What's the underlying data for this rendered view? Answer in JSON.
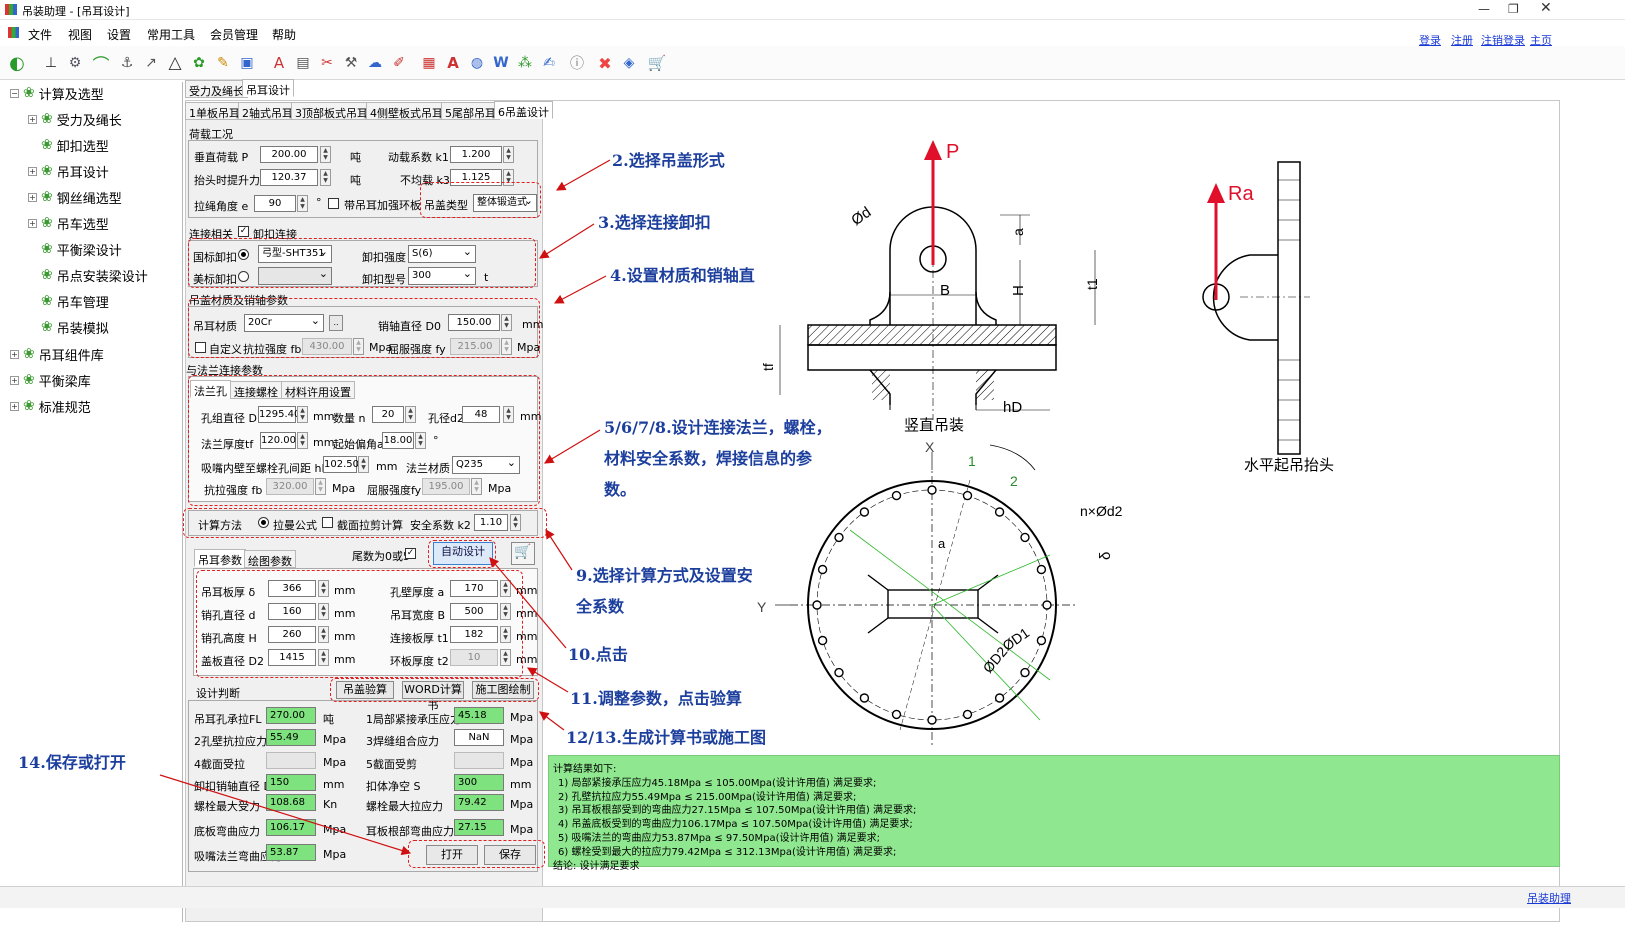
{
  "window": {
    "title": "吊装助理 - [吊耳设计]"
  },
  "menu": [
    "文件",
    "视图",
    "设置",
    "常用工具",
    "会员管理",
    "帮助"
  ],
  "top_links": [
    "登录",
    "注册",
    "注销登录",
    "主页"
  ],
  "tree": [
    {
      "label": "计算及选型",
      "level": 0
    },
    {
      "label": "受力及绳长",
      "level": 1
    },
    {
      "label": "卸扣选型",
      "level": 1
    },
    {
      "label": "吊耳设计",
      "level": 1
    },
    {
      "label": "钢丝绳选型",
      "level": 1
    },
    {
      "label": "吊车选型",
      "level": 1
    },
    {
      "label": "平衡梁设计",
      "level": 1
    },
    {
      "label": "吊点安装梁设计",
      "level": 1
    },
    {
      "label": "吊车管理",
      "level": 1
    },
    {
      "label": "吊装模拟",
      "level": 1
    },
    {
      "label": "吊耳组件库",
      "level": 0
    },
    {
      "label": "平衡梁库",
      "level": 0
    },
    {
      "label": "标准规范",
      "level": 0
    }
  ],
  "outer_tabs": [
    "受力及绳长",
    "吊耳设计"
  ],
  "inner_tabs": [
    "1单板吊耳",
    "2轴式吊耳",
    "3顶部板式吊耳",
    "4侧壁板式吊耳",
    "5尾部吊耳",
    "6吊盖设计"
  ],
  "load": {
    "group": "荷载工况",
    "vload_label": "垂直荷载 P",
    "vload": "200.00",
    "unit_t": "吨",
    "dyn_label": "动载系数 k1",
    "dyn": "1.200",
    "lift_label": "抬头时提升力 Ra",
    "lift": "120.37",
    "uneven_label": "不均载 k3",
    "uneven": "1.125",
    "angle_label": "拉绳角度 e",
    "angle": "90",
    "deg": "°",
    "ring_label": "带吊耳加强环板",
    "cover_type_label": "吊盖类型",
    "cover_type": "整体锻造式"
  },
  "conn": {
    "group": "连接相关",
    "shackle_check": "卸扣连接",
    "gb_label": "国标卸扣",
    "gb_value": "弓型-SHT351",
    "grade_label": "卸扣强度",
    "grade": "S(6)",
    "us_label": "美标卸扣",
    "model_label": "卸扣型号",
    "model": "300",
    "unit_t": "t"
  },
  "mat": {
    "group": "吊盖材质及销轴参数",
    "lug_mat_label": "吊耳材质",
    "lug_mat": "20Cr",
    "pin_label": "销轴直径 D0",
    "pin": "150.00",
    "mm": "mm",
    "custom_label": "自定义",
    "fb_label": "抗拉强度 fb",
    "fb": "430.00",
    "mpa": "Mpa",
    "fy_label": "屈服强度 fy",
    "fy": "215.00"
  },
  "flange": {
    "group": "与法兰连接参数",
    "tabs": [
      "法兰孔",
      "连接螺栓",
      "材料许用设置"
    ],
    "d1_label": "孔组直径 D1",
    "d1": "1295.40",
    "n_label": "数量 n",
    "n": "20",
    "d2_label": "孔径d2",
    "d2": "48",
    "tf_label": "法兰厚度tf",
    "tf": "120.00",
    "start_label": "起始偏角a",
    "start": "18.00",
    "deg": "°",
    "hd_label": "吸嘴内壁至螺栓孔间距 hD",
    "hd": "102.50",
    "fmat_label": "法兰材质",
    "fmat": "Q235",
    "ffb_label": "抗拉强度 fb",
    "ffb": "320.00",
    "ffy_label": "屈服强度fy",
    "ffy": "195.00",
    "mm": "mm",
    "mpa": "Mpa"
  },
  "method": {
    "label": "计算方法",
    "opt1": "拉曼公式",
    "opt2": "截面拉剪计算",
    "k2_label": "安全系数 k2",
    "k2": "1.10"
  },
  "params": {
    "tabs": [
      "吊耳参数",
      "绘图参数"
    ],
    "tail_label": "尾数为0或5",
    "auto_btn": "自动设计",
    "plate_t_label": "吊耳板厚 δ",
    "plate_t": "366",
    "wall_t_label": "孔壁厚度 a",
    "wall_t": "170",
    "pin_d_label": "销孔直径 d",
    "pin_d": "160",
    "lug_w_label": "吊耳宽度 B",
    "lug_w": "500",
    "pin_h_label": "销孔高度 H",
    "pin_h": "260",
    "conn_t_label": "连接板厚 t1",
    "conn_t": "182",
    "cover_d_label": "盖板直径 D2",
    "cover_d": "1415",
    "ring_t_label": "环板厚度 t2",
    "ring_t": "10",
    "mm": "mm"
  },
  "judge": {
    "group": "设计判断",
    "btn_check": "吊盖验算",
    "btn_word": "WORD计算书",
    "btn_draw": "施工图绘制",
    "rows": [
      {
        "l": "吊耳孔承拉FL",
        "v": "270.00",
        "u": "吨",
        "l2": "1局部紧接承压应力",
        "v2": "45.18",
        "u2": "Mpa"
      },
      {
        "l": "2孔壁抗拉应力",
        "v": "55.49",
        "u": "Mpa",
        "l2": "3焊缝组合应力",
        "v2": "NaN",
        "u2": "Mpa"
      },
      {
        "l": "4截面受拉",
        "v": "",
        "u": "Mpa",
        "l2": "5截面受剪",
        "v2": "",
        "u2": "Mpa"
      },
      {
        "l": "卸扣销轴直径 D",
        "v": "150",
        "u": "mm",
        "l2": "扣体净空 S",
        "v2": "300",
        "u2": "mm"
      },
      {
        "l": "螺栓最大受力",
        "v": "108.68",
        "u": "Kn",
        "l2": "螺栓最大拉应力",
        "v2": "79.42",
        "u2": "Mpa"
      },
      {
        "l": "底板弯曲应力",
        "v": "106.17",
        "u": "Mpa",
        "l2": "耳板根部弯曲应力",
        "v2": "27.15",
        "u2": "Mpa"
      },
      {
        "l": "吸嘴法兰弯曲应力",
        "v": "53.87",
        "u": "Mpa"
      }
    ],
    "btn_open": "打开",
    "btn_save": "保存"
  },
  "annotations": [
    "2.选择吊盖形式",
    "3.选择连接卸扣",
    "4.设置材质和销轴直",
    "5/6/7/8.设计连接法兰，螺栓，",
    "材料安全系数，焊接信息的参",
    "数。",
    "9.选择计算方式及设置安",
    "全系数",
    "10.点击",
    "11.调整参数，点击验算",
    "12/13.生成计算书或施工图",
    "14.保存或打开"
  ],
  "drawing": {
    "p": "P",
    "ra": "Ra",
    "vertical": "竖直吊装",
    "horizontal": "水平起吊抬头",
    "x": "X",
    "y": "Y",
    "one": "1",
    "two": "2",
    "nd2": "n×Ød2",
    "delta": "δ",
    "d1": "ØD1",
    "d2": "ØD2",
    "a": "a",
    "a2": "a",
    "od": "Ød",
    "b": "B",
    "h": "H",
    "t1": "t1",
    "tf": "tf",
    "hd": "hD"
  },
  "result": {
    "lines": [
      "计算结果如下:",
      "1) 局部紧接承压应力45.18Mpa ≤ 105.00Mpa(设计许用值) 满足要求;",
      "2) 孔壁抗拉应力55.49Mpa ≤ 215.00Mpa(设计许用值) 满足要求;",
      "3) 吊耳板根部受到的弯曲应力27.15Mpa ≤ 107.50Mpa(设计许用值) 满足要求;",
      "4) 吊盖底板受到的弯曲应力106.17Mpa ≤ 107.50Mpa(设计许用值) 满足要求;",
      "5) 吸嘴法兰的弯曲应力53.87Mpa ≤ 97.50Mpa(设计许用值) 满足要求;",
      "6) 螺栓受到最大的拉应力79.42Mpa ≤ 312.13Mpa(设计许用值) 满足要求;",
      "结论: 设计满足要求"
    ]
  },
  "status": {
    "right": "吊装助理"
  }
}
